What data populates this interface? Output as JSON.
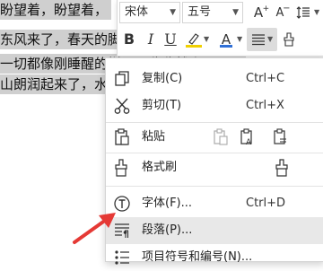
{
  "document": {
    "lines": [
      "盼望着，盼望着，",
      "东风来了，春天的脚步近了",
      "一切都像刚睡醒的样子，欣欣然张开了眼",
      "山朗润起来了，水涨起"
    ]
  },
  "toolbar": {
    "font_name": "宋体",
    "font_size": "五号",
    "bold": "B",
    "italic": "I",
    "underline": "U",
    "font_color_glyph": "A",
    "grow_glyph": "A",
    "shrink_glyph": "A",
    "highlight_color": "#f0d000",
    "font_color": "#2f6fd6"
  },
  "menu": {
    "copy": {
      "label": "复制(C)",
      "shortcut": "Ctrl+C"
    },
    "cut": {
      "label": "剪切(T)",
      "shortcut": "Ctrl+X"
    },
    "paste": {
      "label": "粘贴"
    },
    "format_painter": {
      "label": "格式刷"
    },
    "font": {
      "label": "字体(F)...",
      "shortcut": "Ctrl+D"
    },
    "paragraph": {
      "label": "段落(P)..."
    },
    "bullets": {
      "label": "项目符号和编号(N)..."
    }
  },
  "colors": {
    "selection": "#cfcfcf",
    "highlight_row": "#e8e8e8",
    "annotation_arrow": "#e53935"
  }
}
